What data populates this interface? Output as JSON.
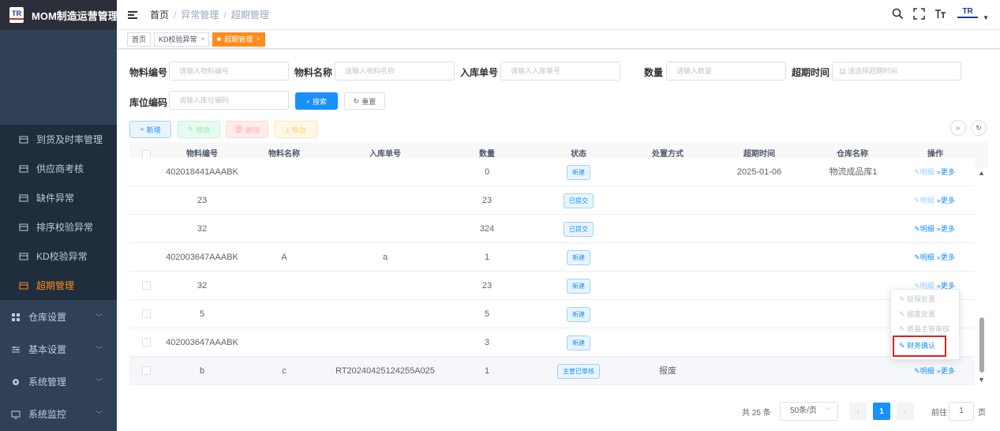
{
  "app": {
    "title": "MOM制造运营管理",
    "logo_text": "TR"
  },
  "sidebar": {
    "items": [
      {
        "label": "到货及时率管理",
        "icon": "table-icon"
      },
      {
        "label": "供应商考核",
        "icon": "table-icon"
      },
      {
        "label": "缺件异常",
        "icon": "table-icon"
      },
      {
        "label": "排序校验异常",
        "icon": "table-icon"
      },
      {
        "label": "KD校验异常",
        "icon": "table-icon"
      },
      {
        "label": "超期管理",
        "icon": "table-icon"
      }
    ],
    "groups": [
      {
        "label": "仓库设置",
        "icon": "grid-icon"
      },
      {
        "label": "基本设置",
        "icon": "sliders-icon"
      },
      {
        "label": "系统管理",
        "icon": "gear-icon"
      },
      {
        "label": "系统监控",
        "icon": "monitor-icon"
      }
    ]
  },
  "breadcrumb": [
    "首页",
    "异常管理",
    "超期管理"
  ],
  "header": {
    "logo_text": "TR"
  },
  "tags": [
    {
      "label": "首页"
    },
    {
      "label": "KD校验异常",
      "close": "×"
    },
    {
      "label": "超期管理",
      "close": "×"
    }
  ],
  "search": {
    "material_no": {
      "label": "物料编号",
      "placeholder": "请输入物料编号"
    },
    "material_name": {
      "label": "物料名称",
      "placeholder": "请输入物料名称"
    },
    "inbound_no": {
      "label": "入库单号",
      "placeholder": "请输入入库单号"
    },
    "quantity": {
      "label": "数量",
      "placeholder": "请输入数量"
    },
    "overdue_time": {
      "label": "超期时间",
      "placeholder": "请选择超期时间"
    },
    "location": {
      "label": "库位编码",
      "placeholder": "请输入库位编码"
    },
    "search_btn": "搜索",
    "reset_btn": "重置"
  },
  "toolbar": {
    "add": "新增",
    "edit": "修改",
    "delete": "删除",
    "export": "导出"
  },
  "table": {
    "columns": [
      "物料编号",
      "物料名称",
      "入库单号",
      "数量",
      "状态",
      "处置方式",
      "超期时间",
      "仓库名称",
      "操作"
    ],
    "detail_label": "明细",
    "more_label": "更多",
    "rows": [
      {
        "material_no": "402018441AAABK",
        "material_name": "",
        "inbound_no": "",
        "qty": "0",
        "status": "新建",
        "disposal": "",
        "overdue": "2025-01-06",
        "warehouse": "物流成品库1",
        "checkbox": false
      },
      {
        "material_no": "23",
        "material_name": "",
        "inbound_no": "",
        "qty": "23",
        "status": "已提交",
        "disposal": "",
        "overdue": "",
        "warehouse": "",
        "checkbox": false
      },
      {
        "material_no": "32",
        "material_name": "",
        "inbound_no": "",
        "qty": "324",
        "status": "已提交",
        "disposal": "",
        "overdue": "",
        "warehouse": "",
        "checkbox": false
      },
      {
        "material_no": "402003647AAABK",
        "material_name": "A",
        "inbound_no": "a",
        "qty": "1",
        "status": "新建",
        "disposal": "",
        "overdue": "",
        "warehouse": "",
        "checkbox": false
      },
      {
        "material_no": "32",
        "material_name": "",
        "inbound_no": "",
        "qty": "23",
        "status": "新建",
        "disposal": "",
        "overdue": "",
        "warehouse": "",
        "checkbox": true
      },
      {
        "material_no": "5",
        "material_name": "",
        "inbound_no": "",
        "qty": "5",
        "status": "新建",
        "disposal": "",
        "overdue": "",
        "warehouse": "",
        "checkbox": true
      },
      {
        "material_no": "402003647AAABK",
        "material_name": "",
        "inbound_no": "",
        "qty": "3",
        "status": "新建",
        "disposal": "",
        "overdue": "",
        "warehouse": "",
        "checkbox": true
      },
      {
        "material_no": "b",
        "material_name": "c",
        "inbound_no": "RT20240425124255A025",
        "qty": "1",
        "status": "主管已审核",
        "disposal": "报废",
        "overdue": "",
        "warehouse": "",
        "checkbox": true
      }
    ]
  },
  "more_menu": [
    "延保处置",
    "报废处置",
    "质量主管审核",
    "财务确认"
  ],
  "pagination": {
    "total": "共 25 条",
    "page_size": "50条/页",
    "current": "1",
    "goto_label": "前往",
    "goto_value": "1",
    "page_unit": "页"
  },
  "colors": {
    "sidebar_bg": "#304156",
    "active": "#ff8c1a",
    "primary": "#1890ff",
    "highlight_border": "#e02020"
  }
}
